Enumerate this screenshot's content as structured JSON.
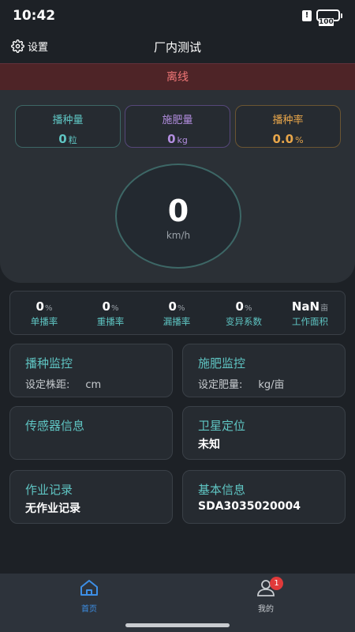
{
  "status_bar": {
    "time": "10:42",
    "alert": "!",
    "battery": "100"
  },
  "header": {
    "settings_label": "设置",
    "title": "厂内测试"
  },
  "connection_status": "离线",
  "stats": [
    {
      "title": "播种量",
      "value": "0",
      "unit": "粒",
      "color": "#5fc5c3",
      "border": "#3d6766"
    },
    {
      "title": "施肥量",
      "value": "0",
      "unit": "kg",
      "color": "#b38ee0",
      "border": "#56477a"
    },
    {
      "title": "播种率",
      "value": "0.0",
      "unit": "%",
      "color": "#e8a64a",
      "border": "#6b5532"
    }
  ],
  "speed": {
    "value": "0",
    "unit": "km/h"
  },
  "metrics": [
    {
      "value": "0",
      "unit": "%",
      "label": "单播率"
    },
    {
      "value": "0",
      "unit": "%",
      "label": "重播率"
    },
    {
      "value": "0",
      "unit": "%",
      "label": "漏播率"
    },
    {
      "value": "0",
      "unit": "%",
      "label": "变异系数"
    },
    {
      "value": "NaN",
      "unit": "亩",
      "label": "工作面积"
    }
  ],
  "cards": {
    "seeding": {
      "title": "播种监控",
      "line_label": "设定株距:",
      "line_unit": "cm"
    },
    "fertilizer": {
      "title": "施肥监控",
      "line_label": "设定肥量:",
      "line_unit": "kg/亩"
    },
    "sensor": {
      "title": "传感器信息"
    },
    "gps": {
      "title": "卫星定位",
      "value": "未知"
    },
    "records": {
      "title": "作业记录",
      "value": "无作业记录"
    },
    "basic": {
      "title": "基本信息",
      "value": "SDA3035020004"
    }
  },
  "tabbar": {
    "home_label": "首页",
    "mine_label": "我的",
    "mine_badge": "1",
    "active_color": "#3d8fe6",
    "inactive_color": "#c8ccd0"
  }
}
